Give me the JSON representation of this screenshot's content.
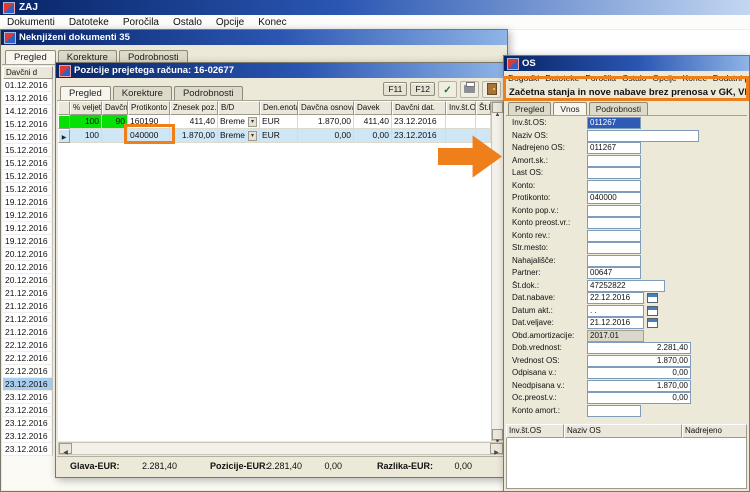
{
  "main_window": {
    "title": "ZAJ",
    "menu": [
      "Dokumenti",
      "Datoteke",
      "Poročila",
      "Ostalo",
      "Opcije",
      "Konec"
    ]
  },
  "docs_window": {
    "title": "Neknjiženi dokumenti 35",
    "tabs": [
      "Pregled",
      "Korekture",
      "Podrobnosti"
    ],
    "active_tab": "Pregled",
    "date_column_header": "Davčni d",
    "selected_date_index": 23,
    "dates": [
      "01.12.2016",
      "13.12.2016",
      "14.12.2016",
      "15.12.2016",
      "15.12.2016",
      "15.12.2016",
      "15.12.2016",
      "15.12.2016",
      "15.12.2016",
      "19.12.2016",
      "19.12.2016",
      "19.12.2016",
      "19.12.2016",
      "20.12.2016",
      "20.12.2016",
      "20.12.2016",
      "21.12.2016",
      "21.12.2016",
      "21.12.2016",
      "21.12.2016",
      "22.12.2016",
      "22.12.2016",
      "22.12.2016",
      "23.12.2016",
      "23.12.2016",
      "23.12.2016",
      "23.12.2016",
      "23.12.2016",
      "23.12.2016"
    ]
  },
  "positions_window": {
    "title": "Pozicije prejetega računa: 16-02677",
    "tabs": [
      "Pregled",
      "Korekture",
      "Podrobnosti"
    ],
    "active_tab": "Pregled",
    "toolbar_buttons": [
      "F11",
      "F12"
    ],
    "grid": {
      "columns": [
        "% veljetnosti",
        "Davčna oz.",
        "Protikonto",
        "Znesek poz.",
        "B/D",
        "Den.enota",
        "Davčna osnova",
        "Davek",
        "Davčni dat.",
        "Inv.št.OS",
        "Št.l"
      ],
      "rows": [
        {
          "highlight": "green",
          "cells": [
            "100",
            "90",
            "160190",
            "411,40",
            "Breme",
            "EUR",
            "1.870,00",
            "411,40",
            "23.12.2016",
            "",
            ""
          ]
        },
        {
          "highlight": "selected",
          "cells": [
            "100",
            "",
            "040000",
            "1.870,00",
            "Breme",
            "EUR",
            "0,00",
            "0,00",
            "23.12.2016",
            "",
            ""
          ]
        }
      ]
    },
    "footer": {
      "glava_label": "Glava-EUR:",
      "glava_value": "2.281,40",
      "pozicije_label": "Pozicije-EUR:",
      "pozicije_value": "2.281,40",
      "pozicije_value2": "0,00",
      "razlika_label": "Razlika-EUR:",
      "razlika_value": "0,00"
    }
  },
  "os_window": {
    "title": "OS",
    "menu": [
      "Dogodki",
      "Datoteke",
      "Poročila",
      "Ostalo",
      "Opcije",
      "Konec",
      "Dodatni post"
    ],
    "banner": "Začetna stanja in nove nabave brez prenosa v GK, VP",
    "tabs": [
      "Pregled",
      "Vnos",
      "Podrobnosti"
    ],
    "active_tab": "Vnos",
    "fields": [
      {
        "label": "Inv.št.OS:",
        "value": "011267",
        "kind": "code",
        "selected": true
      },
      {
        "label": "Naziv OS:",
        "value": "",
        "kind": "name"
      },
      {
        "label": "Nadrejeno OS:",
        "value": "011267",
        "kind": "code"
      },
      {
        "label": "Amort.sk.:",
        "value": "",
        "kind": "code"
      },
      {
        "label": "Last OS:",
        "value": "",
        "kind": "code"
      },
      {
        "label": "Konto:",
        "value": "",
        "kind": "code"
      },
      {
        "label": "Protikonto:",
        "value": "040000",
        "kind": "code"
      },
      {
        "label": "Konto pop.v.:",
        "value": "",
        "kind": "code"
      },
      {
        "label": "Konto preost.vr.:",
        "value": "",
        "kind": "code"
      },
      {
        "label": "Konto rev.:",
        "value": "",
        "kind": "code"
      },
      {
        "label": "Str.mesto:",
        "value": "",
        "kind": "code"
      },
      {
        "label": "Nahajališče:",
        "value": "",
        "kind": "code"
      },
      {
        "label": "Partner:",
        "value": "00647",
        "kind": "code"
      },
      {
        "label": "Št.dok.:",
        "value": "47252822",
        "kind": "med"
      },
      {
        "label": "Dat.nabave:",
        "value": "22.12.2016",
        "kind": "date"
      },
      {
        "label": "Datum akt.:",
        "value": ". .",
        "kind": "date"
      },
      {
        "label": "Dat.veljave:",
        "value": "21.12.2016",
        "kind": "date"
      },
      {
        "label": "Obd.amortizacije:",
        "value": "2017.01",
        "kind": "period"
      },
      {
        "label": "Dob.vrednost:",
        "value": "2.281,40",
        "kind": "num"
      },
      {
        "label": "Vrednost OS:",
        "value": "1.870,00",
        "kind": "num"
      },
      {
        "label": "Odpisana v.:",
        "value": "0,00",
        "kind": "num"
      },
      {
        "label": "Neodpisana v.:",
        "value": "1.870,00",
        "kind": "num"
      },
      {
        "label": "Oc.preost.v.:",
        "value": "0,00",
        "kind": "num"
      },
      {
        "label": "Konto amort.:",
        "value": "",
        "kind": "code"
      }
    ],
    "bottom_grid_columns": [
      "Inv.št.OS",
      "Naziv OS",
      "Nadrejeno"
    ]
  }
}
